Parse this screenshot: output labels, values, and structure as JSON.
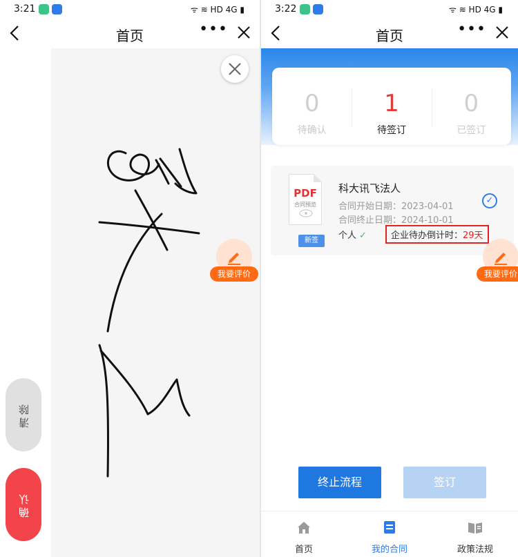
{
  "left": {
    "status": {
      "time": "3:21",
      "right": "ᯤ ≋ HD 4G ▮"
    },
    "nav": {
      "title": "首页",
      "more": "•••"
    },
    "buttons": {
      "clear": "清除",
      "confirm": "确认"
    },
    "eval_label": "我要评价"
  },
  "right": {
    "status": {
      "time": "3:22",
      "right": "ᯤ ≋ HD 4G ▮"
    },
    "nav": {
      "title": "首页",
      "more": "•••"
    },
    "tabs": [
      {
        "count": "0",
        "label": "待确认"
      },
      {
        "count": "1",
        "label": "待签订"
      },
      {
        "count": "0",
        "label": "已签订"
      }
    ],
    "contract": {
      "pdf": "PDF",
      "pdf_sub": "合同预览",
      "badge": "新签",
      "name": "科大讯飞法人",
      "start": "合同开始日期：2023-04-01",
      "end": "合同终止日期：2024-10-01",
      "person": "个人",
      "countdown_label": "企业待办倒计时：",
      "countdown_days": "29天"
    },
    "eval_label": "我要评价",
    "buttons": {
      "stop": "终止流程",
      "sign": "签订"
    },
    "tabbar": [
      {
        "label": "首页",
        "icon": "home-icon"
      },
      {
        "label": "我的合同",
        "icon": "contract-icon"
      },
      {
        "label": "政策法规",
        "icon": "policy-icon"
      }
    ],
    "colors": {
      "primary": "#1f78e0",
      "danger": "#e32222",
      "accent": "#ff6a13"
    }
  }
}
